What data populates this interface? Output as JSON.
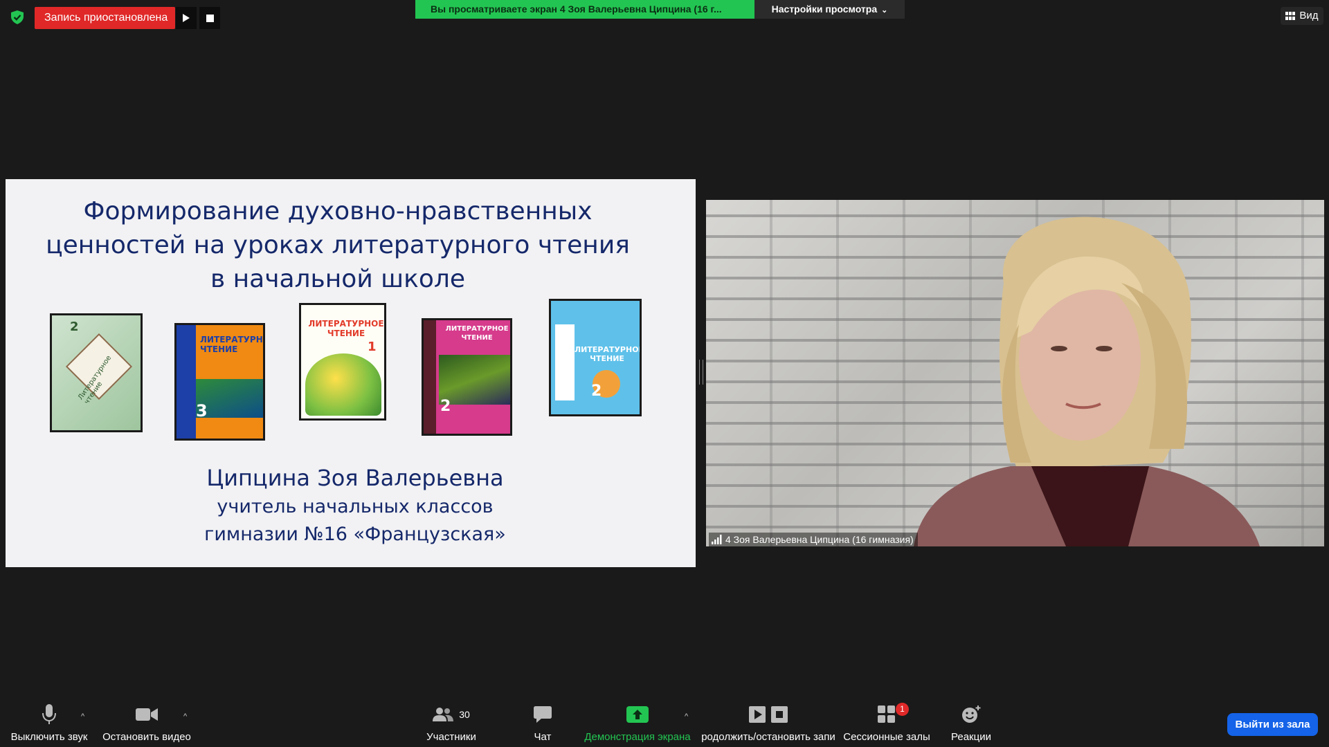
{
  "recording": {
    "status_label": "Запись приостановлена",
    "color": "#e02828"
  },
  "share_banner": {
    "text": "Вы просматриваете экран 4 Зоя Валерьевна Ципцина (16 г...",
    "color": "#23c552"
  },
  "view_settings": {
    "label": "Настройки просмотра"
  },
  "view_button": {
    "label": "Вид"
  },
  "slide": {
    "title_lines": [
      "Формирование духовно-нравственных",
      "ценностей на уроках литературного чтения",
      "в начальной школе"
    ],
    "author_name": "Ципцина Зоя Валерьевна",
    "author_role": "учитель начальных классов",
    "author_school": "гимназии №16 «Французская»",
    "books": [
      {
        "cover_text": "Литературное чтение",
        "grade": "2"
      },
      {
        "cover_text": "ЛИТЕРАТУРНОЕ ЧТЕНИЕ",
        "grade": "3"
      },
      {
        "cover_text": "ЛИТЕРАТУРНОЕ ЧТЕНИЕ",
        "grade": "1"
      },
      {
        "cover_text": "ЛИТЕРАТУРНОЕ ЧТЕНИЕ",
        "grade": "2"
      },
      {
        "cover_text": "ЛИТЕРАТУРНОЕ ЧТЕНИЕ",
        "grade": "2"
      }
    ]
  },
  "camera": {
    "participant_label": "4 Зоя Валерьевна Ципцина (16 гимназия)"
  },
  "toolbar": {
    "mute_label": "Выключить звук",
    "video_label": "Остановить видео",
    "participants_label": "Участники",
    "participants_count": "30",
    "chat_label": "Чат",
    "share_label": "Демонстрация экрана",
    "share_color": "#23c552",
    "record_label": "родолжить/остановить запи",
    "breakout_label": "Сессионные залы",
    "breakout_badge": "1",
    "reactions_label": "Реакции",
    "exit_label": "Выйти из зала",
    "exit_color": "#1463e8"
  }
}
